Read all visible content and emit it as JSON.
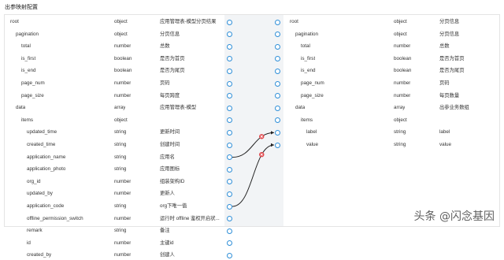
{
  "header": {
    "title": "出参映射配置"
  },
  "left_rows": [
    {
      "name": "root",
      "type": "object",
      "desc": "应用管理表-模型分页结果",
      "level": 0
    },
    {
      "name": "pagination",
      "type": "object",
      "desc": "分页信息",
      "level": 1
    },
    {
      "name": "total",
      "type": "number",
      "desc": "总数",
      "level": 2
    },
    {
      "name": "is_first",
      "type": "boolean",
      "desc": "是否为首页",
      "level": 2
    },
    {
      "name": "is_end",
      "type": "boolean",
      "desc": "是否为尾页",
      "level": 2
    },
    {
      "name": "page_num",
      "type": "number",
      "desc": "页码",
      "level": 2
    },
    {
      "name": "page_size",
      "type": "number",
      "desc": "每页跨度",
      "level": 2
    },
    {
      "name": "data",
      "type": "array",
      "desc": "应用管理表-模型",
      "level": 1
    },
    {
      "name": "items",
      "type": "object",
      "desc": "",
      "level": 2
    },
    {
      "name": "updated_time",
      "type": "string",
      "desc": "更新时间",
      "level": 3
    },
    {
      "name": "created_time",
      "type": "string",
      "desc": "创建时间",
      "level": 3
    },
    {
      "name": "application_name",
      "type": "string",
      "desc": "应用名",
      "level": 3
    },
    {
      "name": "application_photo",
      "type": "string",
      "desc": "应用图标",
      "level": 3
    },
    {
      "name": "org_id",
      "type": "number",
      "desc": "组装架构ID",
      "level": 3
    },
    {
      "name": "updated_by",
      "type": "number",
      "desc": "更新人",
      "level": 3
    },
    {
      "name": "application_code",
      "type": "string",
      "desc": "org下唯一值",
      "level": 3
    },
    {
      "name": "offline_permission_switch",
      "type": "number",
      "desc": "运行时 offline 鉴权开启状...",
      "level": 3
    },
    {
      "name": "remark",
      "type": "string",
      "desc": "备注",
      "level": 3
    },
    {
      "name": "id",
      "type": "number",
      "desc": "主键id",
      "level": 3
    },
    {
      "name": "created_by",
      "type": "number",
      "desc": "创建人",
      "level": 3
    }
  ],
  "right_rows": [
    {
      "name": "root",
      "type": "object",
      "desc": "分页信息",
      "level": 0
    },
    {
      "name": "pagination",
      "type": "object",
      "desc": "分页信息",
      "level": 1
    },
    {
      "name": "total",
      "type": "number",
      "desc": "总数",
      "level": 2
    },
    {
      "name": "is_first",
      "type": "boolean",
      "desc": "是否为首页",
      "level": 2
    },
    {
      "name": "is_end",
      "type": "boolean",
      "desc": "是否为尾页",
      "level": 2
    },
    {
      "name": "page_num",
      "type": "number",
      "desc": "页码",
      "level": 2
    },
    {
      "name": "page_size",
      "type": "number",
      "desc": "每页数量",
      "level": 2
    },
    {
      "name": "data",
      "type": "array",
      "desc": "出参业务数组",
      "level": 1
    },
    {
      "name": "items",
      "type": "object",
      "desc": "",
      "level": 2
    },
    {
      "name": "label",
      "type": "string",
      "desc": "label",
      "level": 3
    },
    {
      "name": "value",
      "type": "string",
      "desc": "value",
      "level": 3
    }
  ],
  "mappings": [
    {
      "from": "application_name",
      "to": "label"
    },
    {
      "from": "application_code",
      "to": "value"
    }
  ],
  "colors": {
    "port": "#2f8fd8",
    "link": "#222222",
    "delete": "#e0474c",
    "mid_bg": "#f2f4f6"
  },
  "watermark": "头条 @闪念基因"
}
